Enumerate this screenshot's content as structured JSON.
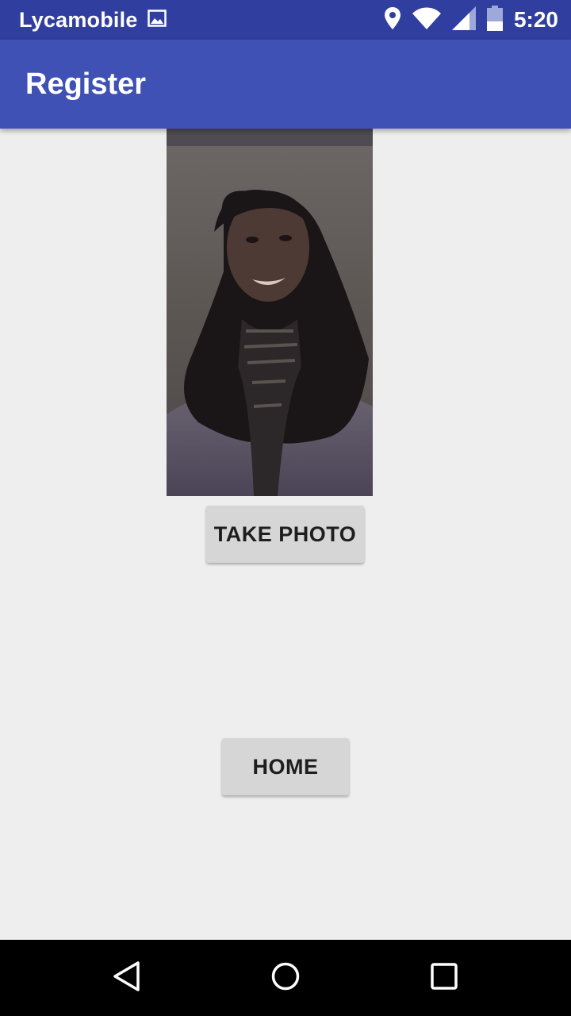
{
  "status_bar": {
    "carrier": "Lycamobile",
    "time": "5:20",
    "icons": [
      "image-icon",
      "location-icon",
      "wifi-icon",
      "signal-icon",
      "battery-icon"
    ]
  },
  "app_bar": {
    "title": "Register"
  },
  "main": {
    "photo_description": "captured-photo",
    "take_photo_label": "TAKE PHOTO",
    "home_label": "HOME"
  },
  "nav_bar": {
    "icons": [
      "back-icon",
      "home-circle-icon",
      "recents-icon"
    ]
  },
  "colors": {
    "status_bar": "#303f9f",
    "app_bar": "#3f51b5",
    "background": "#eeeeee",
    "button": "#d6d6d6"
  }
}
